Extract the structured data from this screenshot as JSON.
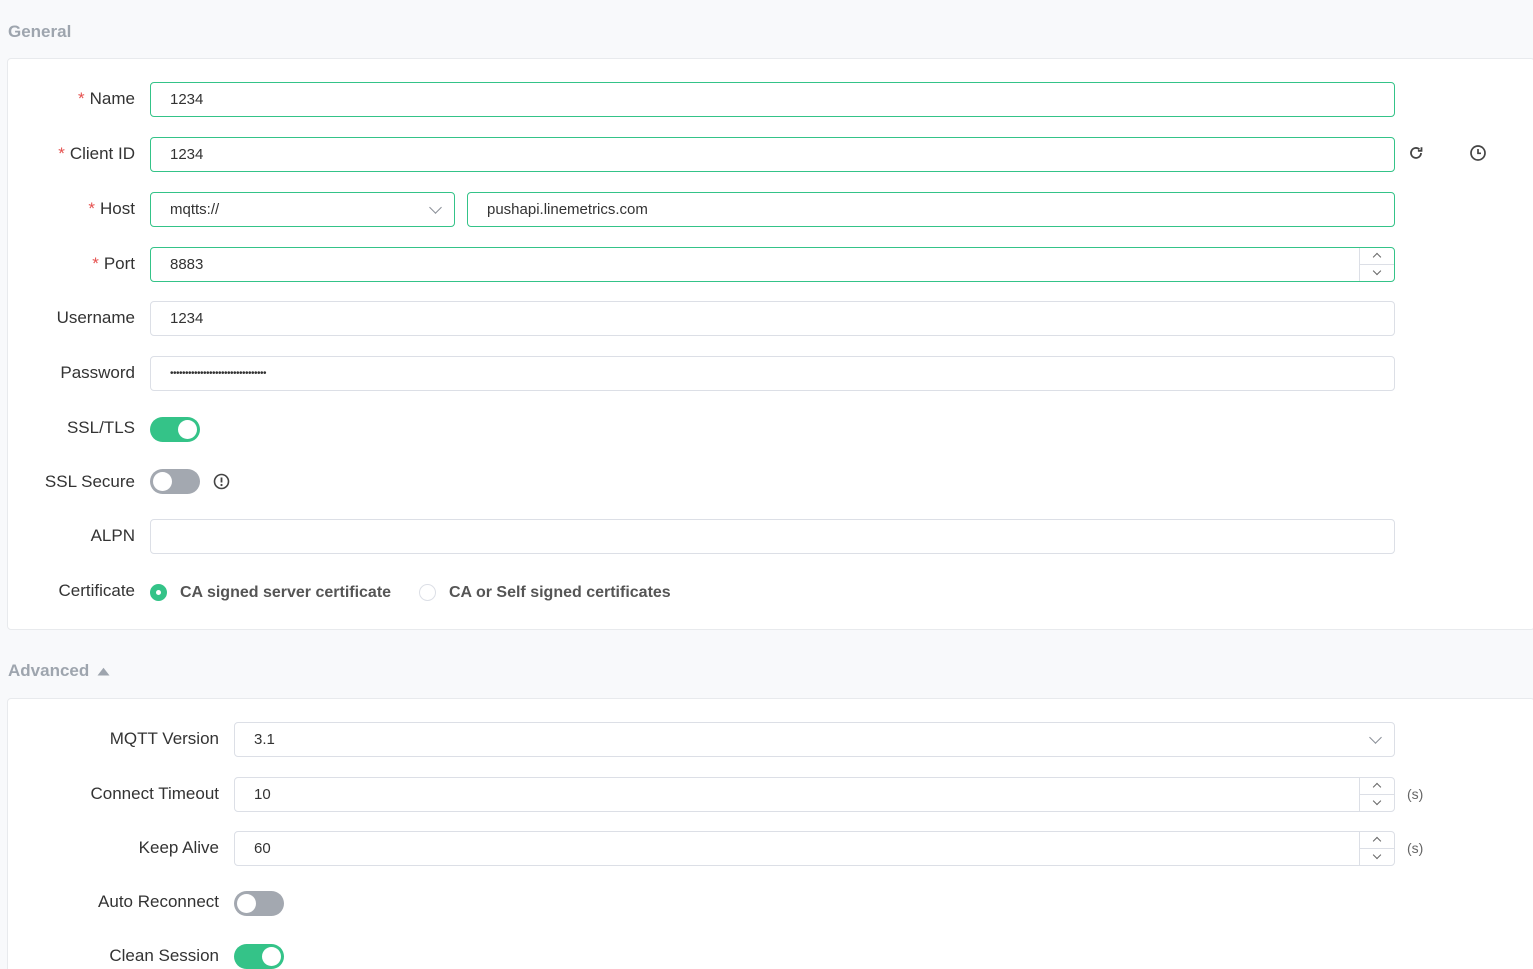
{
  "general": {
    "title": "General",
    "name": {
      "label": "Name",
      "value": "1234"
    },
    "client_id": {
      "label": "Client ID",
      "value": "1234"
    },
    "host": {
      "label": "Host",
      "protocol": "mqtts://",
      "value": "pushapi.linemetrics.com"
    },
    "port": {
      "label": "Port",
      "value": "8883"
    },
    "username": {
      "label": "Username",
      "value": "1234"
    },
    "password": {
      "label": "Password",
      "value": "••••••••••••••••••••••••••••••••"
    },
    "ssl_tls": {
      "label": "SSL/TLS",
      "on": true
    },
    "ssl_secure": {
      "label": "SSL Secure",
      "on": false
    },
    "alpn": {
      "label": "ALPN",
      "value": ""
    },
    "certificate": {
      "label": "Certificate",
      "options": [
        "CA signed server certificate",
        "CA or Self signed certificates"
      ],
      "selected": 0
    },
    "required_mark": "*"
  },
  "advanced": {
    "title": "Advanced",
    "mqtt_version": {
      "label": "MQTT Version",
      "value": "3.1"
    },
    "connect_timeout": {
      "label": "Connect Timeout",
      "value": "10",
      "unit": "(s)"
    },
    "keep_alive": {
      "label": "Keep Alive",
      "value": "60",
      "unit": "(s)"
    },
    "auto_reconnect": {
      "label": "Auto Reconnect",
      "on": false
    },
    "clean_session": {
      "label": "Clean Session",
      "on": true
    }
  },
  "colors": {
    "accent": "#34c388",
    "required": "#e5504e",
    "toggle_off": "#a3a8b0"
  }
}
